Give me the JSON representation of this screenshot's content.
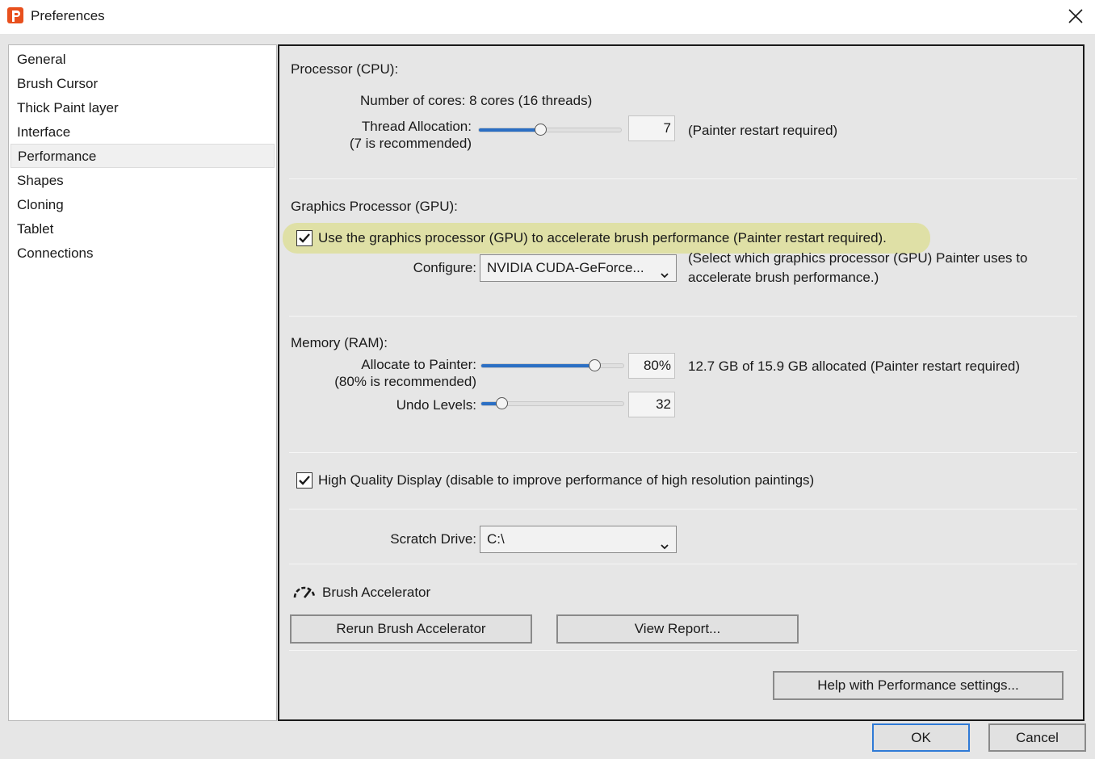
{
  "window": {
    "title": "Preferences"
  },
  "sidebar": {
    "items": [
      {
        "label": "General"
      },
      {
        "label": "Brush Cursor"
      },
      {
        "label": "Thick Paint layer"
      },
      {
        "label": "Interface"
      },
      {
        "label": "Performance",
        "selected": true
      },
      {
        "label": "Shapes"
      },
      {
        "label": "Cloning"
      },
      {
        "label": "Tablet"
      },
      {
        "label": "Connections"
      }
    ]
  },
  "cpu": {
    "heading": "Processor (CPU):",
    "cores_text": "Number of cores: 8 cores (16 threads)",
    "thread_label": "Thread Allocation:",
    "thread_hint": "(7 is recommended)",
    "thread_value": "7",
    "thread_fraction": 0.44,
    "restart_note": "(Painter restart required)"
  },
  "gpu": {
    "heading": "Graphics Processor (GPU):",
    "use_gpu_label": "Use the graphics processor (GPU) to accelerate brush performance (Painter restart required).",
    "use_gpu_checked": true,
    "configure_label": "Configure:",
    "configure_value": "NVIDIA CUDA-GeForce...",
    "configure_note_line1": "(Select which graphics processor (GPU) Painter uses to",
    "configure_note_line2": "accelerate brush performance.)"
  },
  "memory": {
    "heading": "Memory (RAM):",
    "allocate_label": "Allocate to Painter:",
    "allocate_hint": "(80% is recommended)",
    "allocate_value": "80%",
    "allocate_fraction": 0.8,
    "allocate_note": "12.7 GB of 15.9 GB allocated (Painter restart required)",
    "undo_label": "Undo Levels:",
    "undo_value": "32",
    "undo_fraction": 0.15
  },
  "display": {
    "hq_label": "High Quality Display (disable to improve performance of high resolution paintings)",
    "hq_checked": true
  },
  "scratch": {
    "label": "Scratch Drive:",
    "value": "C:\\"
  },
  "accelerator": {
    "heading": "Brush Accelerator",
    "rerun_label": "Rerun Brush Accelerator",
    "report_label": "View Report..."
  },
  "help": {
    "label": "Help with Performance settings..."
  },
  "footer": {
    "ok_label": "OK",
    "cancel_label": "Cancel"
  },
  "colors": {
    "accent": "#2b6fc4",
    "highlight": "#dfe0a6",
    "app_icon": "#e8501d"
  },
  "icons": {
    "app": "painter-app-icon",
    "close": "close-icon",
    "check": "check-icon",
    "chevron": "chevron-down-icon",
    "speedometer": "speedometer-icon"
  }
}
